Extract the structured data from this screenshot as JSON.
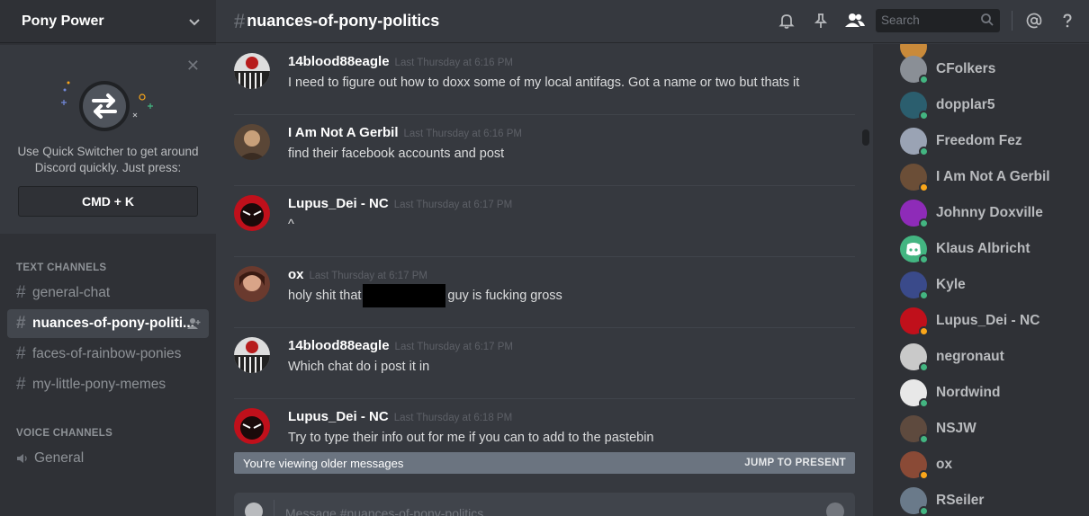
{
  "server": {
    "name": "Pony Power"
  },
  "quick_switcher": {
    "text_line1": "Use Quick Switcher to get around",
    "text_line2": "Discord quickly. Just press:",
    "shortcut": "CMD + K"
  },
  "sidebar": {
    "text_category": "TEXT CHANNELS",
    "voice_category": "VOICE CHANNELS",
    "text_channels": [
      {
        "label": "general-chat"
      },
      {
        "label": "nuances-of-pony-politi..."
      },
      {
        "label": "faces-of-rainbow-ponies"
      },
      {
        "label": "my-little-pony-memes"
      }
    ],
    "voice_channels": [
      {
        "label": "General"
      }
    ]
  },
  "header": {
    "channel_name": "nuances-of-pony-politics",
    "search_placeholder": "Search",
    "hash": "#"
  },
  "messages": [
    {
      "author": "14blood88eagle",
      "timestamp": "Last Thursday at 6:16 PM",
      "text": "I need to figure out how to doxx some of my local antifags. Got a name or two but thats it"
    },
    {
      "author": "I Am Not A Gerbil",
      "timestamp": "Last Thursday at 6:16 PM",
      "text": "find their facebook accounts and post"
    },
    {
      "author": "Lupus_Dei - NC",
      "timestamp": "Last Thursday at 6:17 PM",
      "text": "^"
    },
    {
      "author": "ox",
      "timestamp": "Last Thursday at 6:17 PM",
      "text_before": "holy shit that",
      "text_after": "guy is fucking gross"
    },
    {
      "author": "14blood88eagle",
      "timestamp": "Last Thursday at 6:17 PM",
      "text": "Which chat do i post it in"
    },
    {
      "author": "Lupus_Dei - NC",
      "timestamp": "Last Thursday at 6:18 PM",
      "text": "Try to type their info out for me if you can to add to the pastebin"
    }
  ],
  "older_bar": {
    "text": "You're viewing older messages",
    "jump": "JUMP TO PRESENT"
  },
  "composer": {
    "placeholder": "Message #nuances-of-pony-politics"
  },
  "members": [
    {
      "name": "CFolkers",
      "status": "online"
    },
    {
      "name": "dopplar5",
      "status": "online"
    },
    {
      "name": "Freedom Fez",
      "status": "online"
    },
    {
      "name": "I Am Not A Gerbil",
      "status": "idle"
    },
    {
      "name": "Johnny Doxville",
      "status": "online"
    },
    {
      "name": "Klaus Albricht",
      "status": "online"
    },
    {
      "name": "Kyle",
      "status": "online"
    },
    {
      "name": "Lupus_Dei - NC",
      "status": "idle"
    },
    {
      "name": "negronaut",
      "status": "online"
    },
    {
      "name": "Nordwind",
      "status": "online"
    },
    {
      "name": "NSJW",
      "status": "online"
    },
    {
      "name": "ox",
      "status": "idle"
    },
    {
      "name": "RSeiler",
      "status": "online"
    }
  ],
  "colors": {
    "online": "#43b581",
    "idle": "#faa61a",
    "accent": "#7289da"
  }
}
